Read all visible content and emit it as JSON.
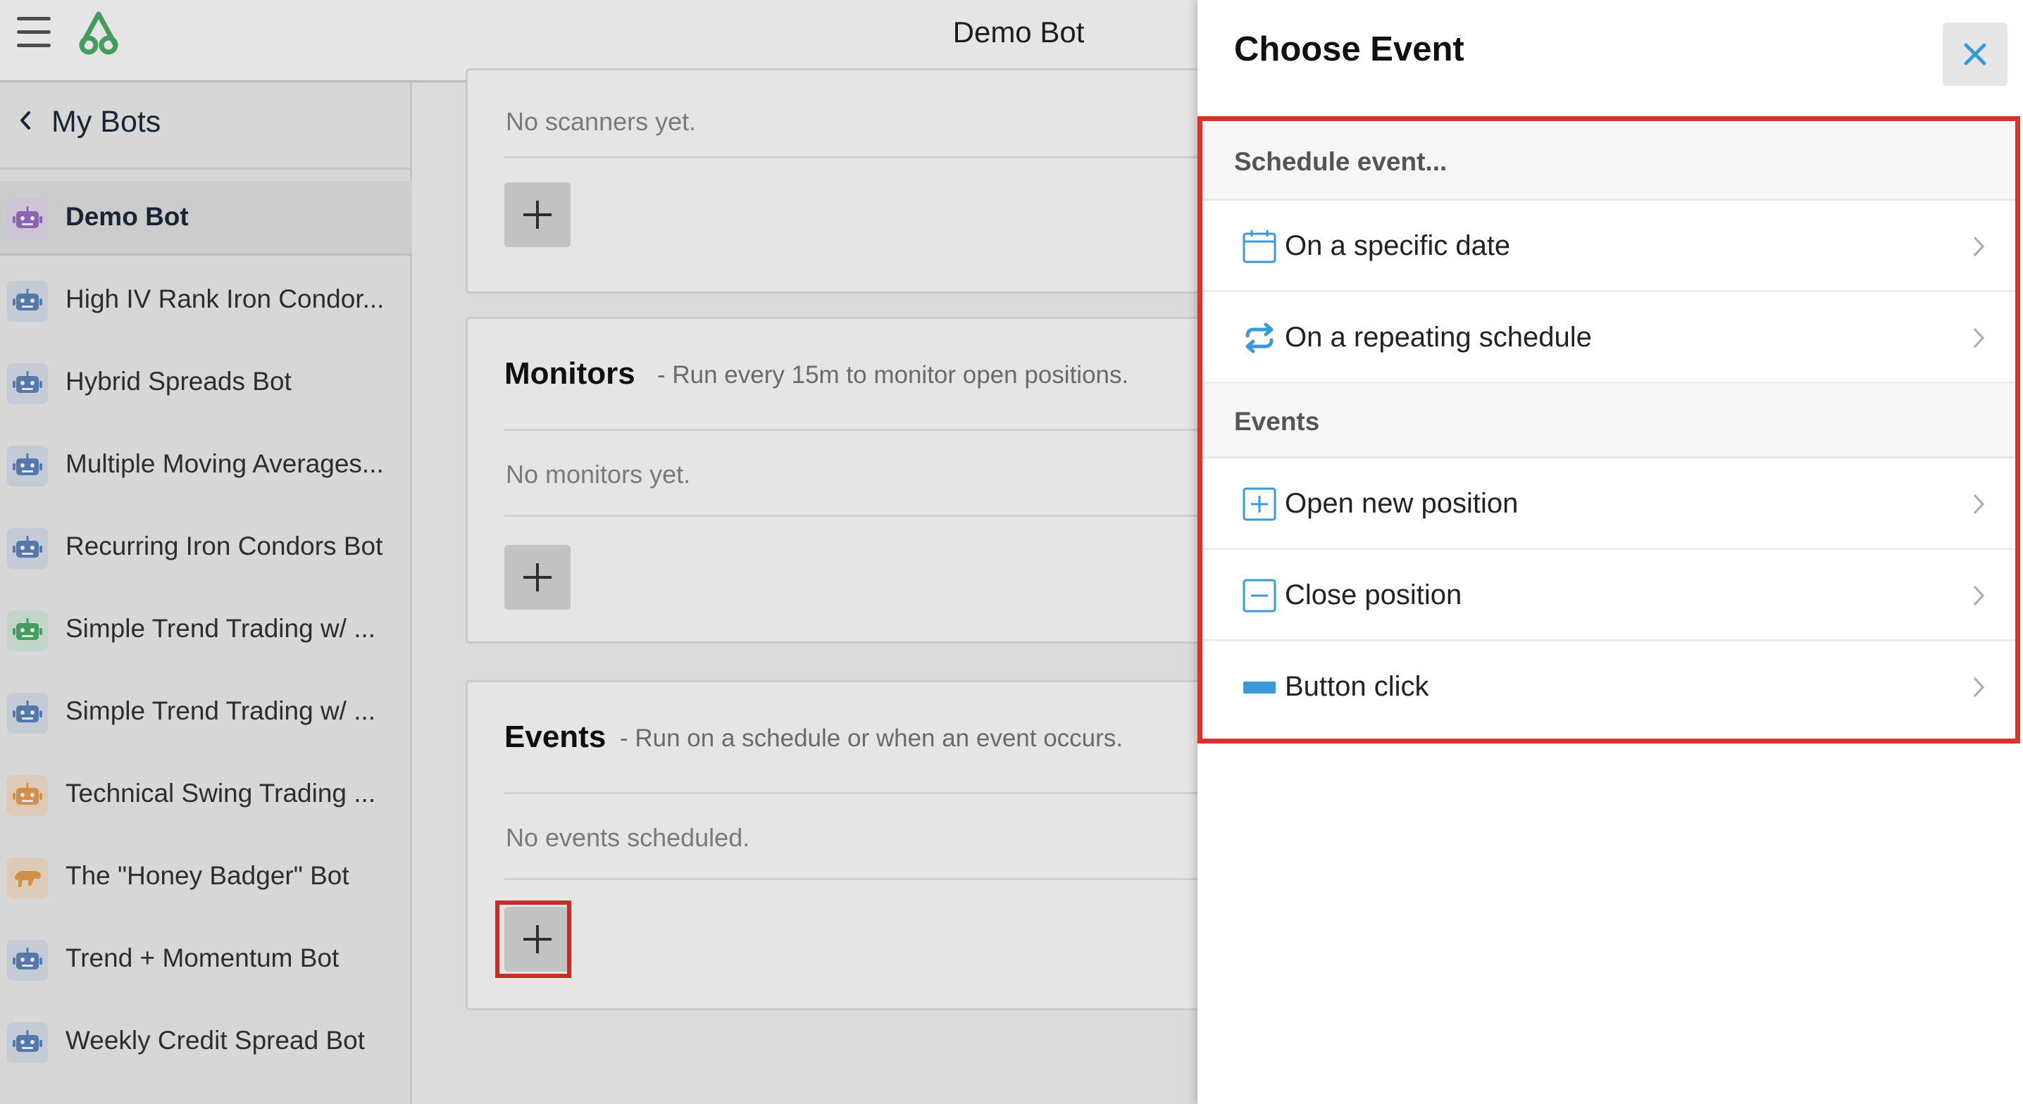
{
  "header": {
    "title": "Demo Bot"
  },
  "sidebar": {
    "back_label": "My Bots",
    "bots": [
      {
        "name": "Demo Bot",
        "color": "#9b6fc6",
        "bg": "#e6dbf1",
        "icon": "robot-icon",
        "active": true
      },
      {
        "name": "High IV Rank Iron Condor...",
        "color": "#5f86c0",
        "bg": "#dae3ef",
        "icon": "robot-icon"
      },
      {
        "name": "Hybrid Spreads Bot",
        "color": "#5f86c0",
        "bg": "#dae3ef",
        "icon": "robot-icon"
      },
      {
        "name": "Multiple Moving Averages...",
        "color": "#5f86c0",
        "bg": "#dae3ef",
        "icon": "robot-icon"
      },
      {
        "name": "Recurring Iron Condors Bot",
        "color": "#5f86c0",
        "bg": "#dae3ef",
        "icon": "robot-icon"
      },
      {
        "name": "Simple Trend Trading w/ ...",
        "color": "#4caf6a",
        "bg": "#d9eedf",
        "icon": "robot-icon"
      },
      {
        "name": "Simple Trend Trading w/ ...",
        "color": "#5f86c0",
        "bg": "#dae3ef",
        "icon": "robot-icon"
      },
      {
        "name": "Technical Swing Trading ...",
        "color": "#e8a152",
        "bg": "#f6e3cc",
        "icon": "robot-icon"
      },
      {
        "name": "The \"Honey Badger\" Bot",
        "color": "#e8a152",
        "bg": "#f6e3cc",
        "icon": "honey-badger-icon"
      },
      {
        "name": "Trend + Momentum Bot",
        "color": "#5f86c0",
        "bg": "#dae3ef",
        "icon": "robot-icon"
      },
      {
        "name": "Weekly Credit Spread Bot",
        "color": "#5f86c0",
        "bg": "#dae3ef",
        "icon": "robot-icon"
      }
    ]
  },
  "main": {
    "scanners": {
      "empty": "No scanners yet."
    },
    "monitors": {
      "title": "Monitors",
      "desc": "- Run every 15m to monitor open positions.",
      "empty": "No monitors yet."
    },
    "events": {
      "title": "Events",
      "desc": "- Run on a schedule or when an event occurs.",
      "empty": "No events scheduled."
    }
  },
  "panel": {
    "title": "Choose Event",
    "close_icon": "close-icon",
    "sections": [
      {
        "label": "Schedule event...",
        "items": [
          {
            "label": "On a specific date",
            "icon": "calendar-icon"
          },
          {
            "label": "On a repeating schedule",
            "icon": "repeat-icon"
          }
        ]
      },
      {
        "label": "Events",
        "items": [
          {
            "label": "Open new position",
            "icon": "plus-square-icon"
          },
          {
            "label": "Close position",
            "icon": "minus-square-icon"
          },
          {
            "label": "Button click",
            "icon": "button-icon"
          }
        ]
      }
    ]
  },
  "colors": {
    "accent": "#3a9ad9",
    "highlight": "#d9342b",
    "brand": "#4caf6a"
  }
}
